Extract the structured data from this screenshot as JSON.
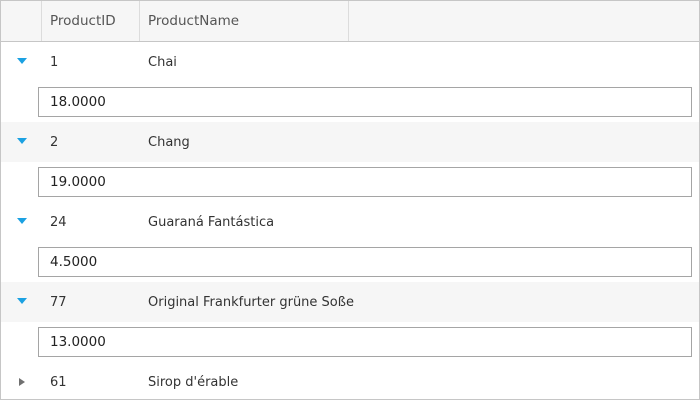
{
  "accent_color": "#1ba1e2",
  "collapsed_icon_color": "#707070",
  "columns": [
    "ProductID",
    "ProductName"
  ],
  "rows": [
    {
      "id": "1",
      "name": "Chai",
      "expanded": true,
      "detail": "18.0000"
    },
    {
      "id": "2",
      "name": "Chang",
      "expanded": true,
      "detail": "19.0000"
    },
    {
      "id": "24",
      "name": "Guaraná Fantástica",
      "expanded": true,
      "detail": "4.5000"
    },
    {
      "id": "77",
      "name": "Original Frankfurter grüne Soße",
      "expanded": true,
      "detail": "13.0000"
    },
    {
      "id": "61",
      "name": "Sirop d'érable",
      "expanded": false,
      "detail": ""
    }
  ]
}
